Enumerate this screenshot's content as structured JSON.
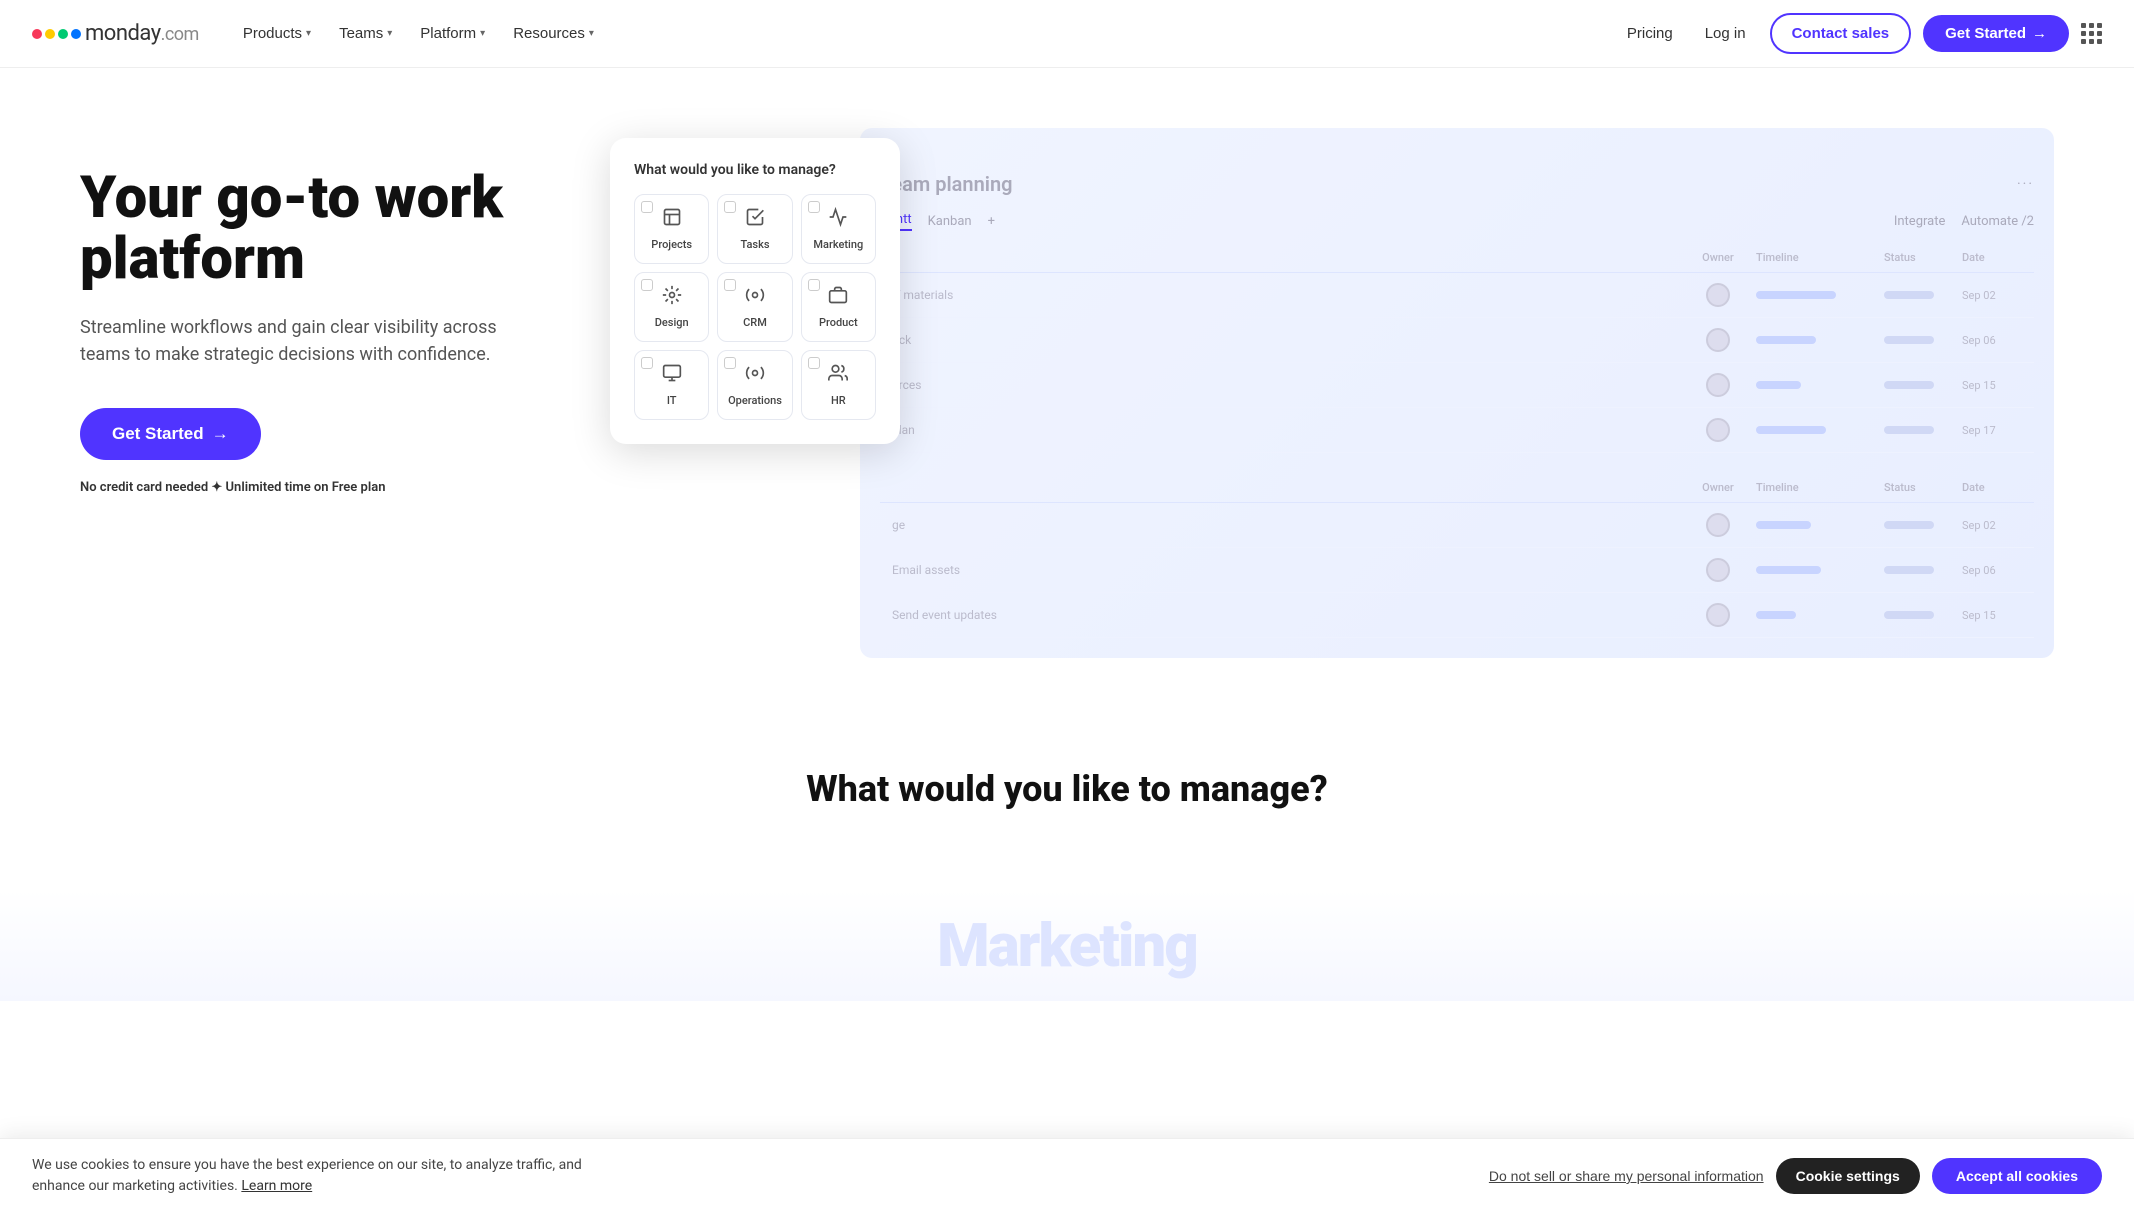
{
  "logo": {
    "text": "monday",
    "suffix": ".com"
  },
  "nav": {
    "links": [
      {
        "label": "Products",
        "id": "products"
      },
      {
        "label": "Teams",
        "id": "teams"
      },
      {
        "label": "Platform",
        "id": "platform"
      },
      {
        "label": "Resources",
        "id": "resources"
      }
    ],
    "pricing": "Pricing",
    "login": "Log in",
    "contact": "Contact sales",
    "get_started": "Get Started"
  },
  "hero": {
    "title": "Your go-to work platform",
    "subtitle": "Streamline workflows and gain clear visibility across teams to make strategic decisions with confidence.",
    "cta": "Get Started",
    "note": "No credit card needed  ✦  Unlimited time on Free plan"
  },
  "dashboard": {
    "title": "Team planning",
    "tabs": [
      "Gantt",
      "Kanban",
      "+"
    ],
    "integrate": "Integrate",
    "automate": "Automate /2",
    "headers": [
      "Owner",
      "Timeline",
      "Status",
      "Date"
    ],
    "rows": [
      {
        "task": "ff materials",
        "date": "Sep 02"
      },
      {
        "task": "ock",
        "date": "Sep 06"
      },
      {
        "task": "urces",
        "date": "Sep 15"
      },
      {
        "task": "plan",
        "date": "Sep 17"
      },
      {
        "task": "ge",
        "date": "Sep 02"
      },
      {
        "task": "Email assets",
        "date": "Sep 06"
      },
      {
        "task": "Send event updates",
        "date": "Sep 15"
      }
    ],
    "timeline_widths": [
      80,
      60,
      45,
      70,
      55,
      65,
      40
    ]
  },
  "modal": {
    "title": "What would you like to manage?",
    "items": [
      {
        "label": "Projects",
        "icon": "📋"
      },
      {
        "label": "Tasks",
        "icon": "✅"
      },
      {
        "label": "Marketing",
        "icon": "📣"
      },
      {
        "label": "Design",
        "icon": "🎨"
      },
      {
        "label": "CRM",
        "icon": "⚙️"
      },
      {
        "label": "Product",
        "icon": "📦"
      },
      {
        "label": "IT",
        "icon": "🖥️"
      },
      {
        "label": "Operations",
        "icon": "⚙️"
      },
      {
        "label": "HR",
        "icon": "👥"
      }
    ]
  },
  "section": {
    "title": "What would you like to manage?"
  },
  "marketing_preview": {
    "heading": "Marketing"
  },
  "cookie": {
    "text": "We use cookies to ensure you have the best experience on our site, to analyze traffic, and enhance our marketing activities.",
    "learn_more": "Learn more",
    "privacy_label": "Do not sell or share my personal information",
    "settings_label": "Cookie settings",
    "accept_label": "Accept all cookies"
  }
}
